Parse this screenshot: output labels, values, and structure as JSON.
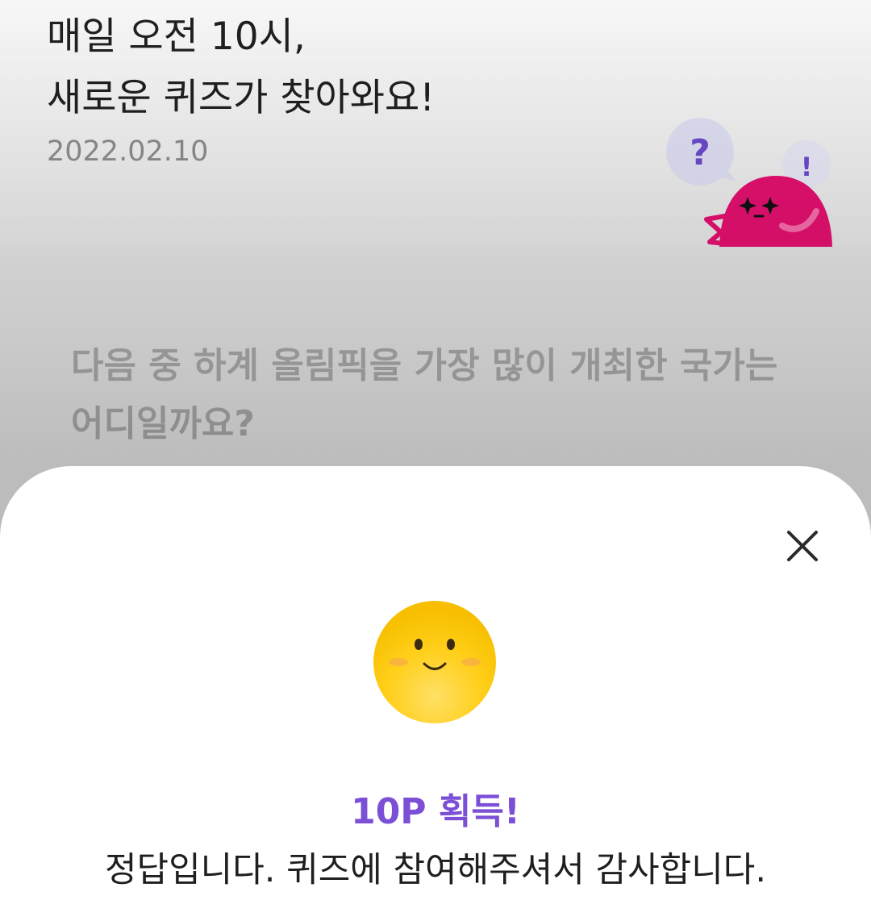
{
  "header": {
    "title_line1": "매일 오전 10시,",
    "title_line2": "새로운 퀴즈가 찾아와요!",
    "date": "2022.02.10",
    "mascot_bubble_left": "?",
    "mascot_bubble_right": "!"
  },
  "quiz": {
    "question": "다음 중 하계 올림픽을 가장 많이 개최한 국가는 어디일까요?"
  },
  "result_sheet": {
    "close_icon": "close-icon",
    "emoji_icon": "smiley-face-icon",
    "reward": "10P 획득!",
    "message": "정답입니다. 퀴즈에 참여해주셔서 감사합니다."
  },
  "colors": {
    "accent_purple": "#7b4fd6",
    "mascot_pink": "#e0106e",
    "smiley_yellow": "#ffca0a"
  }
}
